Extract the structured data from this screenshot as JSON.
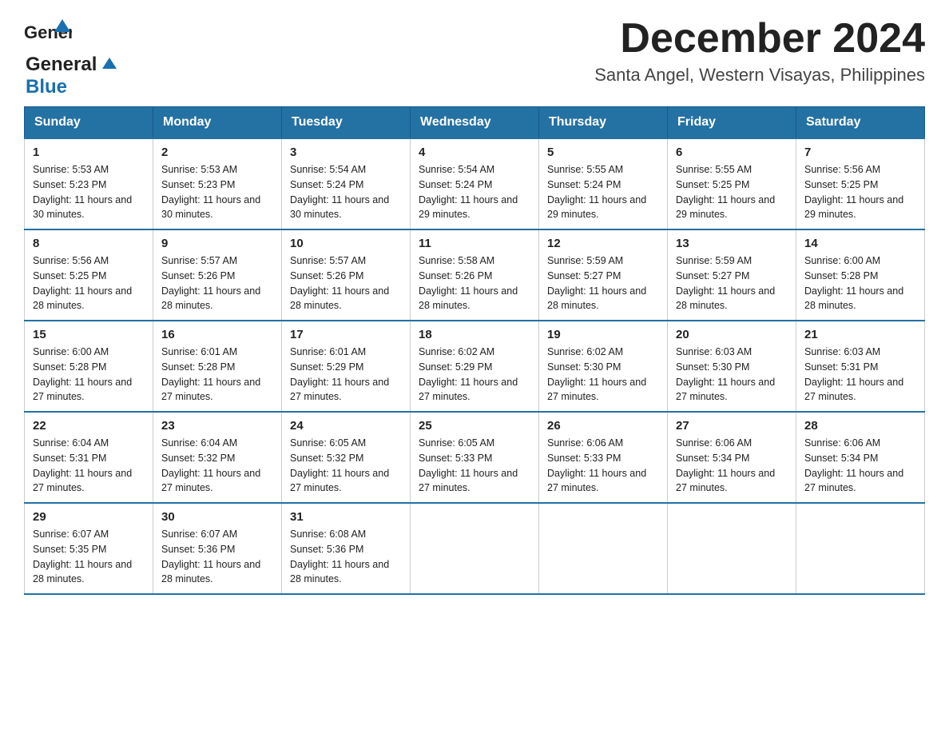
{
  "header": {
    "logo_general": "General",
    "logo_blue": "Blue",
    "month_title": "December 2024",
    "location": "Santa Angel, Western Visayas, Philippines"
  },
  "days_of_week": [
    "Sunday",
    "Monday",
    "Tuesday",
    "Wednesday",
    "Thursday",
    "Friday",
    "Saturday"
  ],
  "weeks": [
    [
      {
        "day": "1",
        "sunrise": "5:53 AM",
        "sunset": "5:23 PM",
        "daylight": "11 hours and 30 minutes."
      },
      {
        "day": "2",
        "sunrise": "5:53 AM",
        "sunset": "5:23 PM",
        "daylight": "11 hours and 30 minutes."
      },
      {
        "day": "3",
        "sunrise": "5:54 AM",
        "sunset": "5:24 PM",
        "daylight": "11 hours and 30 minutes."
      },
      {
        "day": "4",
        "sunrise": "5:54 AM",
        "sunset": "5:24 PM",
        "daylight": "11 hours and 29 minutes."
      },
      {
        "day": "5",
        "sunrise": "5:55 AM",
        "sunset": "5:24 PM",
        "daylight": "11 hours and 29 minutes."
      },
      {
        "day": "6",
        "sunrise": "5:55 AM",
        "sunset": "5:25 PM",
        "daylight": "11 hours and 29 minutes."
      },
      {
        "day": "7",
        "sunrise": "5:56 AM",
        "sunset": "5:25 PM",
        "daylight": "11 hours and 29 minutes."
      }
    ],
    [
      {
        "day": "8",
        "sunrise": "5:56 AM",
        "sunset": "5:25 PM",
        "daylight": "11 hours and 28 minutes."
      },
      {
        "day": "9",
        "sunrise": "5:57 AM",
        "sunset": "5:26 PM",
        "daylight": "11 hours and 28 minutes."
      },
      {
        "day": "10",
        "sunrise": "5:57 AM",
        "sunset": "5:26 PM",
        "daylight": "11 hours and 28 minutes."
      },
      {
        "day": "11",
        "sunrise": "5:58 AM",
        "sunset": "5:26 PM",
        "daylight": "11 hours and 28 minutes."
      },
      {
        "day": "12",
        "sunrise": "5:59 AM",
        "sunset": "5:27 PM",
        "daylight": "11 hours and 28 minutes."
      },
      {
        "day": "13",
        "sunrise": "5:59 AM",
        "sunset": "5:27 PM",
        "daylight": "11 hours and 28 minutes."
      },
      {
        "day": "14",
        "sunrise": "6:00 AM",
        "sunset": "5:28 PM",
        "daylight": "11 hours and 28 minutes."
      }
    ],
    [
      {
        "day": "15",
        "sunrise": "6:00 AM",
        "sunset": "5:28 PM",
        "daylight": "11 hours and 27 minutes."
      },
      {
        "day": "16",
        "sunrise": "6:01 AM",
        "sunset": "5:28 PM",
        "daylight": "11 hours and 27 minutes."
      },
      {
        "day": "17",
        "sunrise": "6:01 AM",
        "sunset": "5:29 PM",
        "daylight": "11 hours and 27 minutes."
      },
      {
        "day": "18",
        "sunrise": "6:02 AM",
        "sunset": "5:29 PM",
        "daylight": "11 hours and 27 minutes."
      },
      {
        "day": "19",
        "sunrise": "6:02 AM",
        "sunset": "5:30 PM",
        "daylight": "11 hours and 27 minutes."
      },
      {
        "day": "20",
        "sunrise": "6:03 AM",
        "sunset": "5:30 PM",
        "daylight": "11 hours and 27 minutes."
      },
      {
        "day": "21",
        "sunrise": "6:03 AM",
        "sunset": "5:31 PM",
        "daylight": "11 hours and 27 minutes."
      }
    ],
    [
      {
        "day": "22",
        "sunrise": "6:04 AM",
        "sunset": "5:31 PM",
        "daylight": "11 hours and 27 minutes."
      },
      {
        "day": "23",
        "sunrise": "6:04 AM",
        "sunset": "5:32 PM",
        "daylight": "11 hours and 27 minutes."
      },
      {
        "day": "24",
        "sunrise": "6:05 AM",
        "sunset": "5:32 PM",
        "daylight": "11 hours and 27 minutes."
      },
      {
        "day": "25",
        "sunrise": "6:05 AM",
        "sunset": "5:33 PM",
        "daylight": "11 hours and 27 minutes."
      },
      {
        "day": "26",
        "sunrise": "6:06 AM",
        "sunset": "5:33 PM",
        "daylight": "11 hours and 27 minutes."
      },
      {
        "day": "27",
        "sunrise": "6:06 AM",
        "sunset": "5:34 PM",
        "daylight": "11 hours and 27 minutes."
      },
      {
        "day": "28",
        "sunrise": "6:06 AM",
        "sunset": "5:34 PM",
        "daylight": "11 hours and 27 minutes."
      }
    ],
    [
      {
        "day": "29",
        "sunrise": "6:07 AM",
        "sunset": "5:35 PM",
        "daylight": "11 hours and 28 minutes."
      },
      {
        "day": "30",
        "sunrise": "6:07 AM",
        "sunset": "5:36 PM",
        "daylight": "11 hours and 28 minutes."
      },
      {
        "day": "31",
        "sunrise": "6:08 AM",
        "sunset": "5:36 PM",
        "daylight": "11 hours and 28 minutes."
      },
      null,
      null,
      null,
      null
    ]
  ]
}
